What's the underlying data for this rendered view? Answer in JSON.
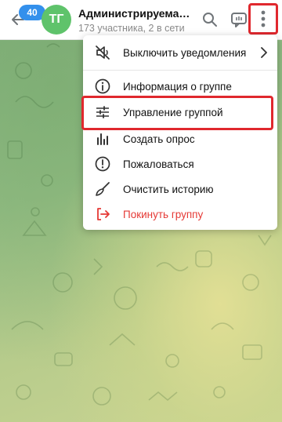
{
  "header": {
    "unread_badge": "40",
    "avatar_initials": "ТГ",
    "title": "Администрируемая группа",
    "subtitle": "173 участника, 2 в сети"
  },
  "menu": {
    "items": [
      {
        "label": "Выключить уведомления",
        "icon": "mute-icon"
      },
      {
        "label": "Информация о группе",
        "icon": "info-icon"
      },
      {
        "label": "Управление группой",
        "icon": "settings-sliders-icon"
      },
      {
        "label": "Создать опрос",
        "icon": "poll-icon"
      },
      {
        "label": "Пожаловаться",
        "icon": "report-icon"
      },
      {
        "label": "Очистить историю",
        "icon": "broom-icon"
      },
      {
        "label": "Покинуть группу",
        "icon": "leave-icon"
      }
    ]
  },
  "colors": {
    "accent": "#3390ec",
    "avatar": "#5fc36b",
    "danger": "#e53935",
    "highlight": "#e0282e"
  }
}
